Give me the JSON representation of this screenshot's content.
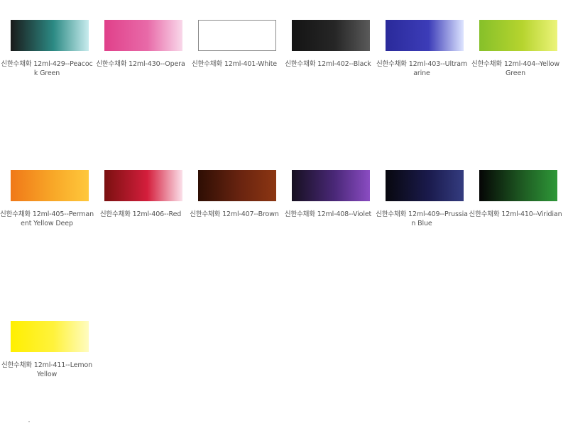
{
  "products": [
    {
      "label": "신한수채화 12ml-429--Peacock Green",
      "swatch_start": "#1a1a1a",
      "swatch_mid": "#2c8a84",
      "swatch_end": "#c8ecee",
      "outlined": false
    },
    {
      "label": "신한수채화 12ml-430--Opera",
      "swatch_start": "#e0408a",
      "swatch_mid": "#e86aa8",
      "swatch_end": "#f9d8ea",
      "outlined": false
    },
    {
      "label": "신한수채화 12ml-401-White",
      "swatch_start": "#ffffff",
      "swatch_mid": "#ffffff",
      "swatch_end": "#ffffff",
      "outlined": true
    },
    {
      "label": "신한수채화 12ml-402--Black",
      "swatch_start": "#141414",
      "swatch_mid": "#262626",
      "swatch_end": "#5a5a5a",
      "outlined": false
    },
    {
      "label": "신한수채화 12ml-403--Ultramarine",
      "swatch_start": "#2a2a9a",
      "swatch_mid": "#3c3cb8",
      "swatch_end": "#dde4ff",
      "outlined": false
    },
    {
      "label": "신한수채화 12ml-404--Yellow Green",
      "swatch_start": "#86c02a",
      "swatch_mid": "#b6d42e",
      "swatch_end": "#ecf47a",
      "outlined": false
    },
    {
      "label": "신한수채화 12ml-405--Permanent Yellow Deep",
      "swatch_start": "#f07818",
      "swatch_mid": "#f8a828",
      "swatch_end": "#ffc83c",
      "outlined": false
    },
    {
      "label": "신한수채화 12ml-406--Red",
      "swatch_start": "#7a1010",
      "swatch_mid": "#d41e3c",
      "swatch_end": "#fbe0ea",
      "outlined": false
    },
    {
      "label": "신한수채화 12ml-407--Brown",
      "swatch_start": "#2e0e04",
      "swatch_mid": "#6a2410",
      "swatch_end": "#8c3612",
      "outlined": false
    },
    {
      "label": "신한수채화 12ml-408--Violet",
      "swatch_start": "#161020",
      "swatch_mid": "#4a2878",
      "swatch_end": "#8a4cc2",
      "outlined": false
    },
    {
      "label": "신한수채화 12ml-409--Prussian Blue",
      "swatch_start": "#08080e",
      "swatch_mid": "#1a1a4c",
      "swatch_end": "#343c80",
      "outlined": false
    },
    {
      "label": "신한수채화 12ml-410--Viridian",
      "swatch_start": "#050505",
      "swatch_mid": "#1e5a22",
      "swatch_end": "#2e9838",
      "outlined": false
    },
    {
      "label": "신한수채화 12ml-411--Lemon Yellow",
      "swatch_start": "#ffef00",
      "swatch_mid": "#fff23c",
      "swatch_end": "#fffcc0",
      "outlined": false
    }
  ]
}
